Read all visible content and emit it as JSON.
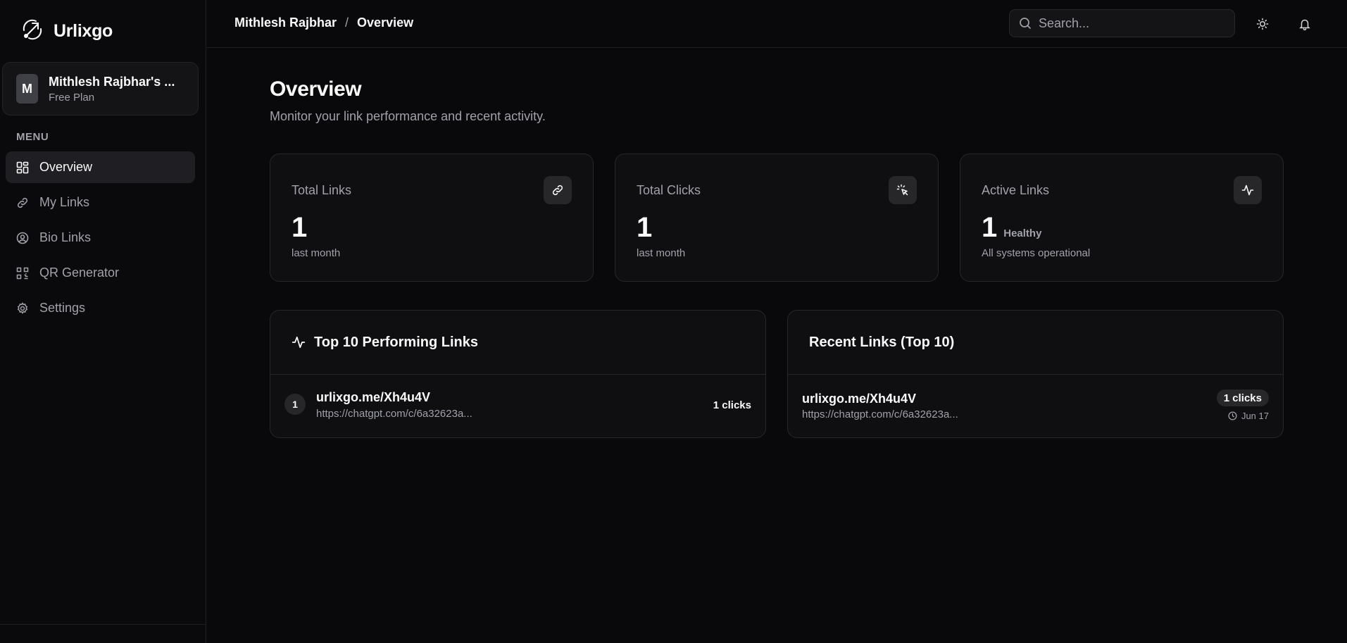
{
  "app": {
    "name": "Urlixgo"
  },
  "workspace": {
    "initial": "M",
    "name": "Mithlesh Rajbhar's ...",
    "plan": "Free Plan"
  },
  "sidebar": {
    "menu_label": "MENU",
    "items": [
      {
        "label": "Overview",
        "icon": "grid-icon",
        "active": true
      },
      {
        "label": "My Links",
        "icon": "link-icon",
        "active": false
      },
      {
        "label": "Bio Links",
        "icon": "user-circle-icon",
        "active": false
      },
      {
        "label": "QR Generator",
        "icon": "qr-code-icon",
        "active": false
      },
      {
        "label": "Settings",
        "icon": "gear-icon",
        "active": false
      }
    ]
  },
  "header": {
    "breadcrumb": [
      "Mithlesh Rajbhar",
      "Overview"
    ],
    "separator": "/",
    "search_placeholder": "Search..."
  },
  "main": {
    "title": "Overview",
    "subtitle": "Monitor your link performance and recent activity.",
    "stats": [
      {
        "title": "Total Links",
        "value": "1",
        "note": "last month",
        "icon": "link-icon"
      },
      {
        "title": "Total Clicks",
        "value": "1",
        "note": "last month",
        "icon": "cursor-click-icon"
      },
      {
        "title": "Active Links",
        "value": "1",
        "tag": "Healthy",
        "note": "All systems operational",
        "icon": "activity-icon"
      }
    ],
    "top_links": {
      "title": "Top 10 Performing Links",
      "rows": [
        {
          "rank": "1",
          "short": "urlixgo.me/Xh4u4V",
          "dest": "https://chatgpt.com/c/6a32623a...",
          "clicks": "1 clicks"
        }
      ]
    },
    "recent_links": {
      "title": "Recent Links (Top 10)",
      "rows": [
        {
          "short": "urlixgo.me/Xh4u4V",
          "dest": "https://chatgpt.com/c/6a32623a...",
          "clicks": "1 clicks",
          "date": "Jun 17"
        }
      ]
    }
  },
  "colors": {
    "background": "#09090b",
    "card": "#0f0f12",
    "border": "#27272a",
    "muted": "#a1a1aa"
  }
}
